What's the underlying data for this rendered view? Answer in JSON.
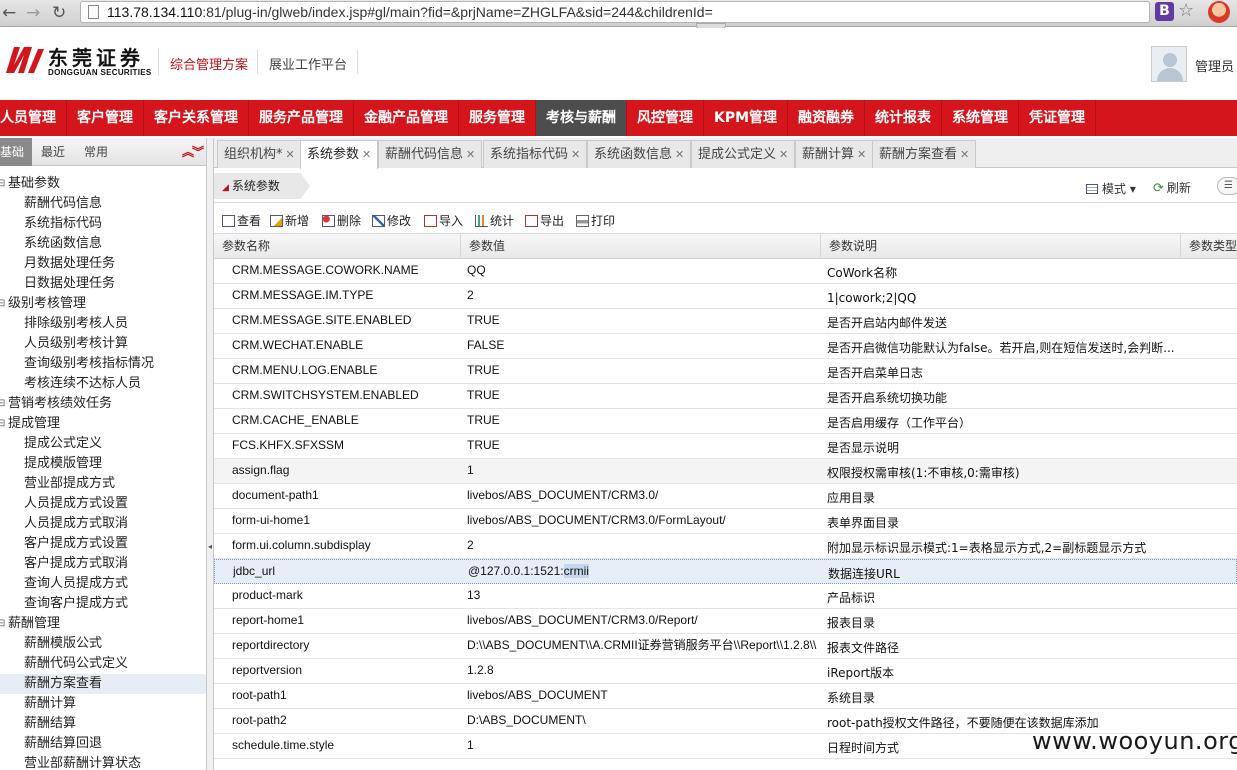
{
  "browser": {
    "url_host": "113.78.134.110",
    "url_rest": ":81/plug-in/glweb/index.jsp#gl/main?fid=&prjName=ZHGLFA&sid=244&childrenId=",
    "ext_label": "B"
  },
  "header": {
    "logo_cn": "东莞证券",
    "logo_en": "DONGGUAN SECURITIES",
    "links": [
      "综合管理方案",
      "展业工作平台"
    ],
    "user": "管理员"
  },
  "mainnav": [
    "人员管理",
    "客户管理",
    "客户关系管理",
    "服务产品管理",
    "金融产品管理",
    "服务管理",
    "考核与薪酬",
    "风控管理",
    "KPM管理",
    "融资融券",
    "统计报表",
    "系统管理",
    "凭证管理"
  ],
  "sidebar": {
    "tabs": [
      "基础",
      "最近",
      "常用"
    ],
    "collapse": "⌃⌄",
    "tree": [
      {
        "label": "基础参数",
        "level": 0
      },
      {
        "label": "薪酬代码信息",
        "level": 1
      },
      {
        "label": "系统指标代码",
        "level": 1
      },
      {
        "label": "系统函数信息",
        "level": 1
      },
      {
        "label": "月数据处理任务",
        "level": 1
      },
      {
        "label": "日数据处理任务",
        "level": 1
      },
      {
        "label": "级别考核管理",
        "level": 0
      },
      {
        "label": "排除级别考核人员",
        "level": 1
      },
      {
        "label": "人员级别考核计算",
        "level": 1
      },
      {
        "label": "查询级别考核指标情况",
        "level": 1
      },
      {
        "label": "考核连续不达标人员",
        "level": 1
      },
      {
        "label": "营销考核绩效任务",
        "level": 0
      },
      {
        "label": "提成管理",
        "level": 0
      },
      {
        "label": "提成公式定义",
        "level": 1
      },
      {
        "label": "提成模版管理",
        "level": 1
      },
      {
        "label": "营业部提成方式",
        "level": 1
      },
      {
        "label": "人员提成方式设置",
        "level": 1
      },
      {
        "label": "人员提成方式取消",
        "level": 1
      },
      {
        "label": "客户提成方式设置",
        "level": 1
      },
      {
        "label": "客户提成方式取消",
        "level": 1
      },
      {
        "label": "查询人员提成方式",
        "level": 1
      },
      {
        "label": "查询客户提成方式",
        "level": 1
      },
      {
        "label": "薪酬管理",
        "level": 0
      },
      {
        "label": "薪酬模版公式",
        "level": 1
      },
      {
        "label": "薪酬代码公式定义",
        "level": 1
      },
      {
        "label": "薪酬方案查看",
        "level": 1
      },
      {
        "label": "薪酬计算",
        "level": 1
      },
      {
        "label": "薪酬结算",
        "level": 1
      },
      {
        "label": "薪酬结算回退",
        "level": 1
      },
      {
        "label": "营业部薪酬计算状态",
        "level": 1
      }
    ]
  },
  "tabs": [
    "组织机构*",
    "系统参数",
    "薪酬代码信息",
    "系统指标代码",
    "系统函数信息",
    "提成公式定义",
    "薪酬计算",
    "薪酬方案查看"
  ],
  "page_title": "系统参数",
  "view_mode": "模式",
  "refresh": "刷新",
  "toolbar": [
    "查看",
    "新增",
    "删除",
    "修改",
    "导入",
    "统计",
    "导出",
    "打印"
  ],
  "columns": [
    "参数名称",
    "参数值",
    "参数说明",
    "参数类型"
  ],
  "rows": [
    [
      "CRM.MESSAGE.COWORK.NAME",
      "QQ",
      "CoWork名称"
    ],
    [
      "CRM.MESSAGE.IM.TYPE",
      "2",
      "1|cowork;2|QQ"
    ],
    [
      "CRM.MESSAGE.SITE.ENABLED",
      "TRUE",
      "是否开启站内邮件发送"
    ],
    [
      "CRM.WECHAT.ENABLE",
      "FALSE",
      "是否开启微信功能默认为false。若开启,则在短信发送时,会判断..."
    ],
    [
      "CRM.MENU.LOG.ENABLE",
      "TRUE",
      "是否开启菜单日志"
    ],
    [
      "CRM.SWITCHSYSTEM.ENABLED",
      "TRUE",
      "是否开启系统切换功能"
    ],
    [
      "CRM.CACHE_ENABLE",
      "TRUE",
      "是否启用缓存（工作平台）"
    ],
    [
      "FCS.KHFX.SFXSSM",
      "TRUE",
      "是否显示说明"
    ],
    [
      "assign.flag",
      "1",
      "权限授权需审核(1:不审核,0:需审核)"
    ],
    [
      "document-path1",
      "livebos/ABS_DOCUMENT/CRM3.0/",
      "应用目录"
    ],
    [
      "form-ui-home1",
      "livebos/ABS_DOCUMENT/CRM3.0/FormLayout/",
      "表单界面目录"
    ],
    [
      "form.ui.column.subdisplay",
      "2",
      "附加显示标识显示模式:1=表格显示方式,2=副标题显示方式"
    ],
    [
      "jdbc_url",
      "@127.0.0.1:1521:crmii",
      "数据连接URL"
    ],
    [
      "product-mark",
      "13",
      "产品标识"
    ],
    [
      "report-home1",
      "livebos/ABS_DOCUMENT/CRM3.0/Report/",
      "报表目录"
    ],
    [
      "reportdirectory",
      "D:\\\\ABS_DOCUMENT\\\\A.CRMII证券营销服务平台\\\\Report\\\\1.2.8\\\\",
      "报表文件路径"
    ],
    [
      "reportversion",
      "1.2.8",
      "iReport版本"
    ],
    [
      "root-path1",
      "livebos/ABS_DOCUMENT",
      "系统目录"
    ],
    [
      "root-path2",
      "D:\\ABS_DOCUMENT\\",
      "root-path授权文件路径，不要随便在该数据库添加"
    ],
    [
      "schedule.time.style",
      "1",
      "日程时间方式"
    ]
  ],
  "watermark": "www.wooyun.org"
}
